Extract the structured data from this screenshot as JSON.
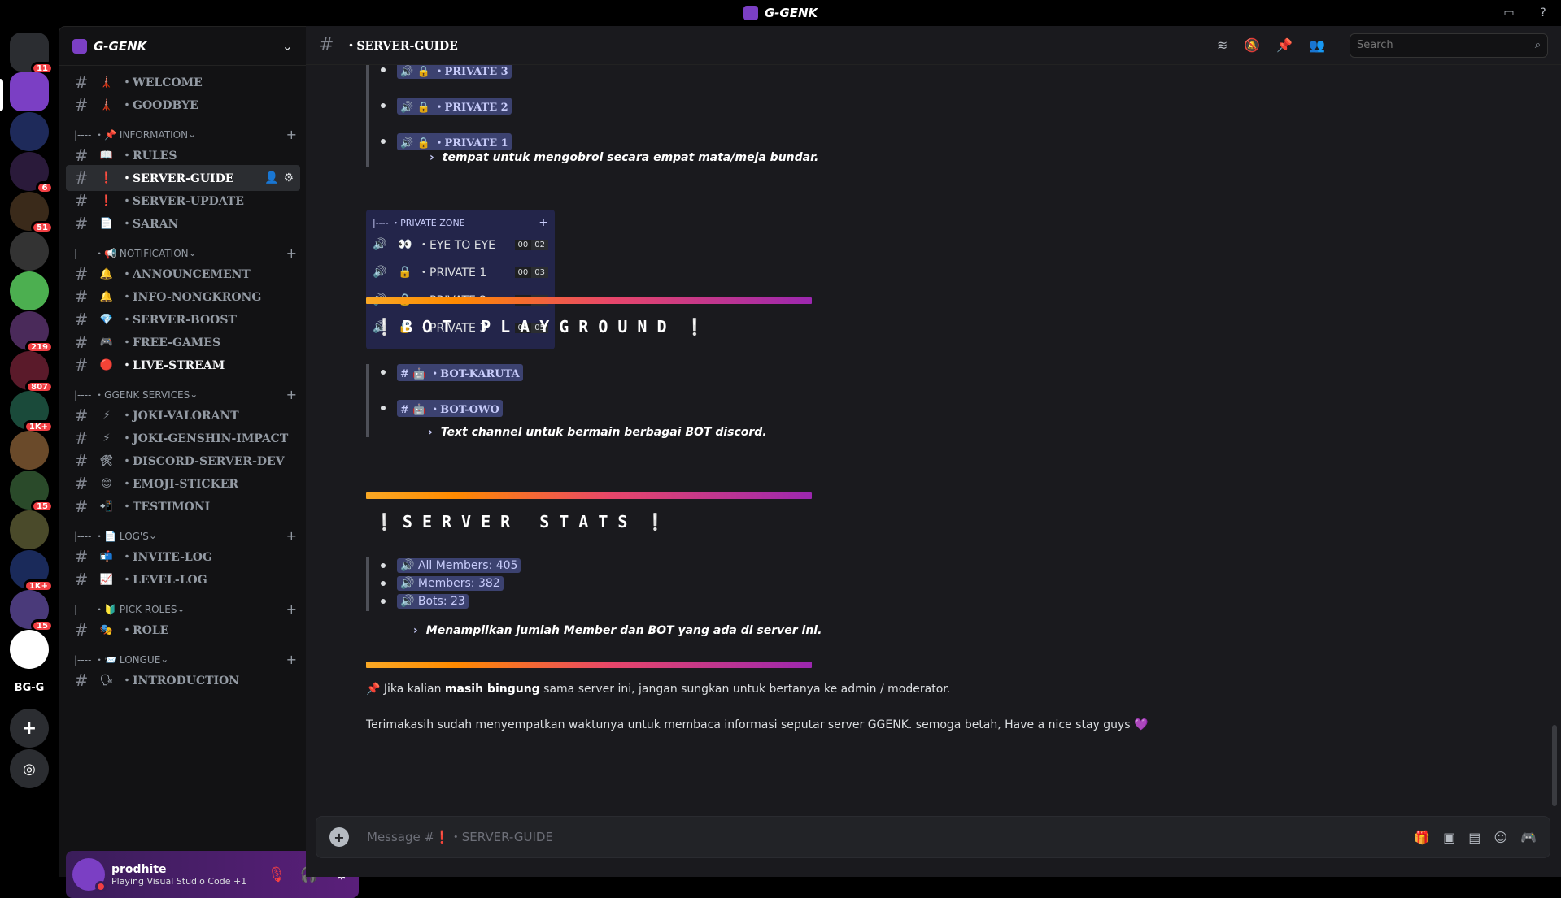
{
  "window": {
    "title": "G-GENK"
  },
  "rail": {
    "servers": [
      {
        "name": "home",
        "badge": "11"
      },
      {
        "name": "ggenk-server",
        "badge": ""
      },
      {
        "name": "server-3",
        "badge": ""
      },
      {
        "name": "server-4",
        "badge": "6"
      },
      {
        "name": "server-5",
        "badge": "51"
      },
      {
        "name": "server-6",
        "badge": ""
      },
      {
        "name": "server-7",
        "badge": ""
      },
      {
        "name": "folder-1",
        "badge": "219"
      },
      {
        "name": "folder-2",
        "badge": "807"
      },
      {
        "name": "folder-3",
        "badge": "1K+"
      },
      {
        "name": "server-11",
        "badge": ""
      },
      {
        "name": "folder-4",
        "badge": "15"
      },
      {
        "name": "folder-5",
        "badge": ""
      },
      {
        "name": "folder-6",
        "badge": "1K+"
      },
      {
        "name": "folder-7",
        "badge": "15"
      },
      {
        "name": "server-16",
        "badge": ""
      }
    ],
    "text_server": "BG-G"
  },
  "sidebar": {
    "server_name": "G-GENK",
    "items": [
      {
        "kind": "channel",
        "emoji": "🗼",
        "label": "・WELCOME"
      },
      {
        "kind": "channel",
        "emoji": "🗼",
        "label": "・GOODBYE"
      },
      {
        "kind": "category",
        "label": "|---- ・📌 INFORMATION"
      },
      {
        "kind": "channel",
        "emoji": "📖",
        "label": "・RULES"
      },
      {
        "kind": "channel",
        "emoji": "❗",
        "label": "・SERVER-GUIDE",
        "active": true
      },
      {
        "kind": "channel",
        "emoji": "❗",
        "label": "・SERVER-UPDATE"
      },
      {
        "kind": "channel",
        "emoji": "📄",
        "label": "・SARAN"
      },
      {
        "kind": "category",
        "label": "|---- ・📢 NOTIFICATION"
      },
      {
        "kind": "channel",
        "emoji": "🔔",
        "label": "・ANNOUNCEMENT"
      },
      {
        "kind": "channel",
        "emoji": "🔔",
        "label": "・INFO-NONGKRONG"
      },
      {
        "kind": "channel",
        "emoji": "💎",
        "label": "・SERVER-BOOST"
      },
      {
        "kind": "channel",
        "emoji": "🎮",
        "label": "・FREE-GAMES"
      },
      {
        "kind": "channel",
        "emoji": "🔴",
        "label": "・LIVE-STREAM",
        "bold": true
      },
      {
        "kind": "category",
        "label": "|---- ・GGENK SERVICES"
      },
      {
        "kind": "channel",
        "emoji": "⚡",
        "label": "・JOKI-VALORANT"
      },
      {
        "kind": "channel",
        "emoji": "⚡",
        "label": "・JOKI-GENSHIN-IMPACT"
      },
      {
        "kind": "channel",
        "emoji": "🛠",
        "label": "・DISCORD-SERVER-DEV"
      },
      {
        "kind": "channel",
        "emoji": "😊",
        "label": "・EMOJI-STICKER"
      },
      {
        "kind": "channel",
        "emoji": "📲",
        "label": "・TESTIMONI"
      },
      {
        "kind": "category",
        "label": "|---- ・📄 LOG'S"
      },
      {
        "kind": "channel",
        "emoji": "📬",
        "label": "・INVITE-LOG"
      },
      {
        "kind": "channel",
        "emoji": "📈",
        "label": "・LEVEL-LOG"
      },
      {
        "kind": "category",
        "label": "|---- ・🔰 PICK ROLES"
      },
      {
        "kind": "channel",
        "emoji": "🎭",
        "label": "・ROLE"
      },
      {
        "kind": "category",
        "label": "|---- ・📨 LONGUE"
      },
      {
        "kind": "channel",
        "emoji": "🗣",
        "label": "・INTRODUCTION"
      }
    ]
  },
  "user": {
    "name": "prodhite",
    "status": "Playing Visual Studio Code +1"
  },
  "header": {
    "channel": "・SERVER-GUIDE",
    "search_placeholder": "Search"
  },
  "messages": {
    "private_top": "・PRIVATE 3",
    "private2": "・PRIVATE 2",
    "private1": "・PRIVATE 1",
    "private_desc": "tempat untuk mengobrol secara empat mata/meja bundar.",
    "embed_category": "|---- ・PRIVATE ZONE",
    "voice_channels": [
      {
        "icon": "👀",
        "name": "・EYE TO EYE",
        "a": "00",
        "b": "02"
      },
      {
        "icon": "🔒",
        "name": "・PRIVATE 1",
        "a": "00",
        "b": "03"
      },
      {
        "icon": "🔒",
        "name": "・PRIVATE 2",
        "a": "00",
        "b": "04"
      },
      {
        "icon": "🔒",
        "name": "・PRIVATE 3",
        "a": "00",
        "b": "05"
      }
    ],
    "bot_heading": "BOT PLAYGROUND",
    "bot_channels": [
      "・BOT-KARUTA",
      "・BOT-OWO"
    ],
    "bot_desc": "Text channel untuk bermain berbagai BOT discord.",
    "stats_heading": "SERVER STATS",
    "stats": [
      "All Members: 405",
      "Members: 382",
      "Bots: 23"
    ],
    "stats_desc": "Menampilkan jumlah Member dan BOT yang ada di server ini.",
    "pin_pre": "Jika kalian ",
    "pin_bold": "masih bingung",
    "pin_post": " sama server ini, jangan sungkan untuk bertanya ke admin / moderator.",
    "thanks": "Terimakasih sudah menyempatkan waktunya untuk membaca informasi seputar server GGENK. semoga betah, Have a nice stay guys 💜"
  },
  "composer": {
    "placeholder": "Message #❗・SERVER-GUIDE"
  }
}
